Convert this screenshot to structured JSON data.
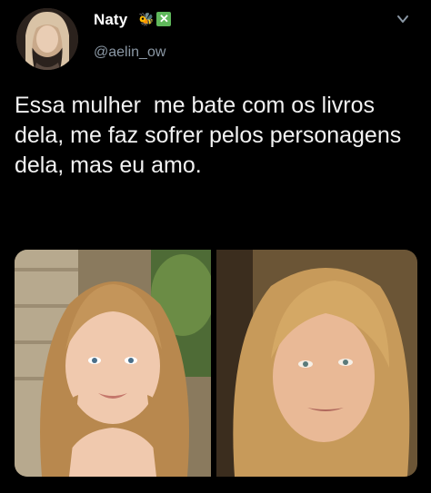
{
  "author": {
    "display_name": "Naty",
    "handle": "@aelin_ow",
    "badge_emoji": "🐝",
    "badge_check": "✕"
  },
  "tweet": {
    "text": "Essa mulher  me bate com os livros dela, me faz sofrer pelos personagens dela, mas eu amo."
  },
  "icons": {
    "avatar": "avatar-portrait",
    "more": "chevron-down-icon"
  },
  "colors": {
    "background": "#000000",
    "text": "#ffffff",
    "secondary_text": "#8b98a5",
    "badge_green": "#5fb85b"
  },
  "media": {
    "count": 2,
    "items": [
      "portrait-photo-left",
      "portrait-photo-right"
    ]
  }
}
